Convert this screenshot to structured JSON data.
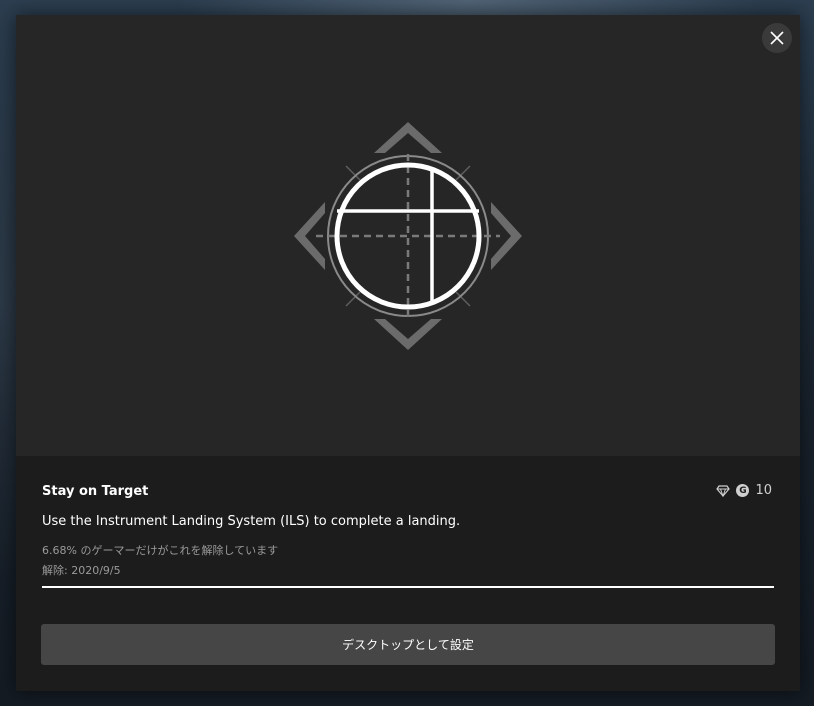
{
  "achievement": {
    "title": "Stay on Target",
    "description": "Use the Instrument Landing System (ILS) to complete a landing.",
    "rarity_text": "6.68% のゲーマーだけがこれを解除しています",
    "unlocked_text": "解除: 2020/9/5",
    "gamerscore": "10",
    "gamerscore_badge": "G",
    "progress": 1.0,
    "rarity_icon": "diamond-icon",
    "art_icon": "ils-crosshair-icon"
  },
  "actions": {
    "set_desktop_label": "デスクトップとして設定"
  },
  "controls": {
    "close_icon": "close-icon"
  },
  "colors": {
    "panel": "#1c1c1c",
    "hero": "#262626",
    "button": "#464646",
    "text_primary": "#ffffff",
    "text_secondary": "#9a9a9a"
  }
}
